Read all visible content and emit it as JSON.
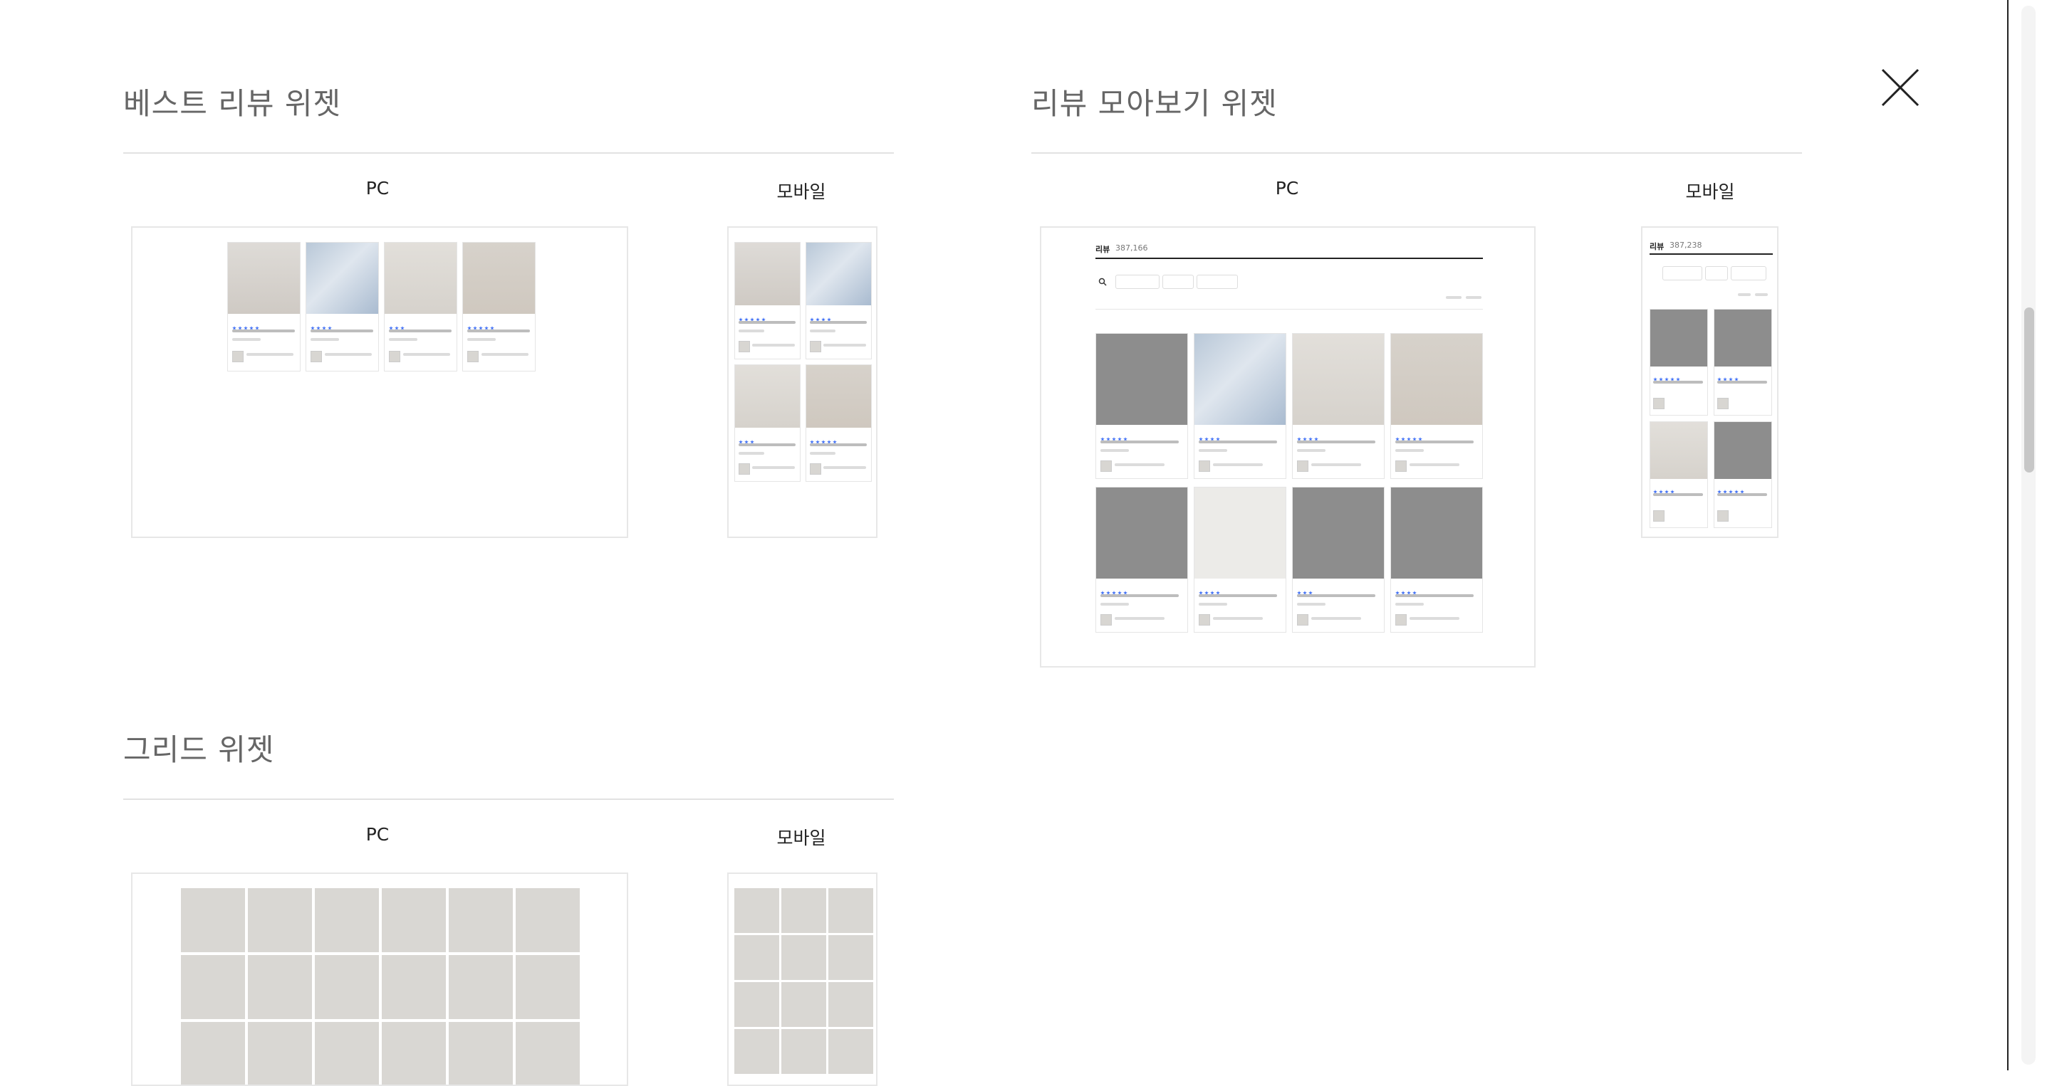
{
  "sections": {
    "best": {
      "title": "베스트 리뷰 위젯",
      "pc_label": "PC",
      "mobile_label": "모바일"
    },
    "collect": {
      "title": "리뷰 모아보기 위젯",
      "pc_label": "PC",
      "mobile_label": "모바일",
      "pc_heading": "리뷰",
      "pc_count": "387,166",
      "mobile_heading": "리뷰",
      "mobile_count": "387,238"
    },
    "grid": {
      "title": "그리드 위젯",
      "pc_label": "PC",
      "mobile_label": "모바일"
    }
  },
  "icons": {
    "close": "close-icon",
    "search": "search-icon",
    "star": "star-icon"
  },
  "colors": {
    "accent": "#3d6ef5",
    "title_gray": "#666666"
  }
}
